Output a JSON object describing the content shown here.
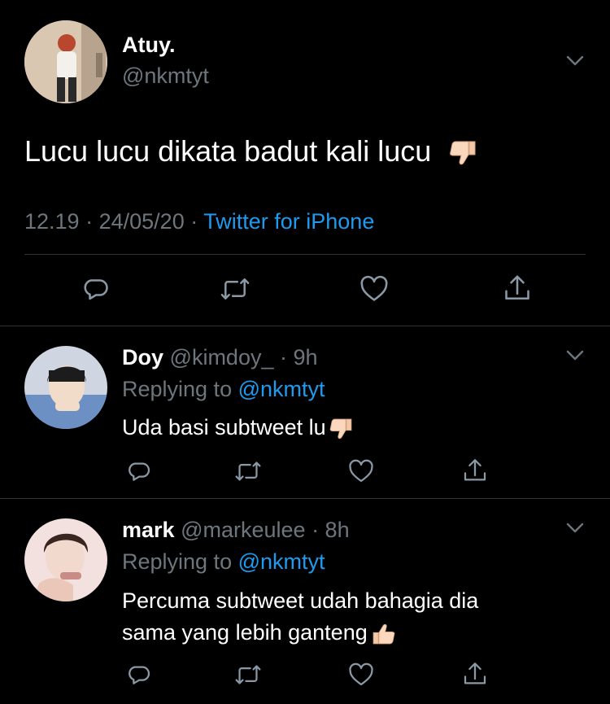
{
  "main_tweet": {
    "display_name": "Atuy.",
    "handle": "@nkmtyt",
    "text": "Lucu lucu dikata badut kali lucu",
    "emoji": "thumbs-down",
    "time": "12.19",
    "date": "24/05/20",
    "separator": "·",
    "source": "Twitter for iPhone"
  },
  "replies": [
    {
      "display_name": "Doy",
      "handle": "@kimdoy_",
      "age": "· 9h",
      "replying_prefix": "Replying to",
      "replying_handle": "@nkmtyt",
      "text_line1": "Uda basi subtweet lu",
      "text_line2": "",
      "emoji": "thumbs-down"
    },
    {
      "display_name": "mark",
      "handle": "@markeulee",
      "age": "· 8h",
      "replying_prefix": "Replying to",
      "replying_handle": "@nkmtyt",
      "text_line1": "Percuma subtweet udah bahagia dia",
      "text_line2": "sama yang lebih ganteng",
      "emoji": "thumbs-up"
    }
  ],
  "icons": [
    "reply-icon",
    "retweet-icon",
    "like-icon",
    "share-icon",
    "caret-down-icon"
  ],
  "colors": {
    "background": "#000000",
    "text": "#ffffff",
    "muted": "#6e767d",
    "link": "#1d9bf0",
    "divider": "#2f3336"
  }
}
